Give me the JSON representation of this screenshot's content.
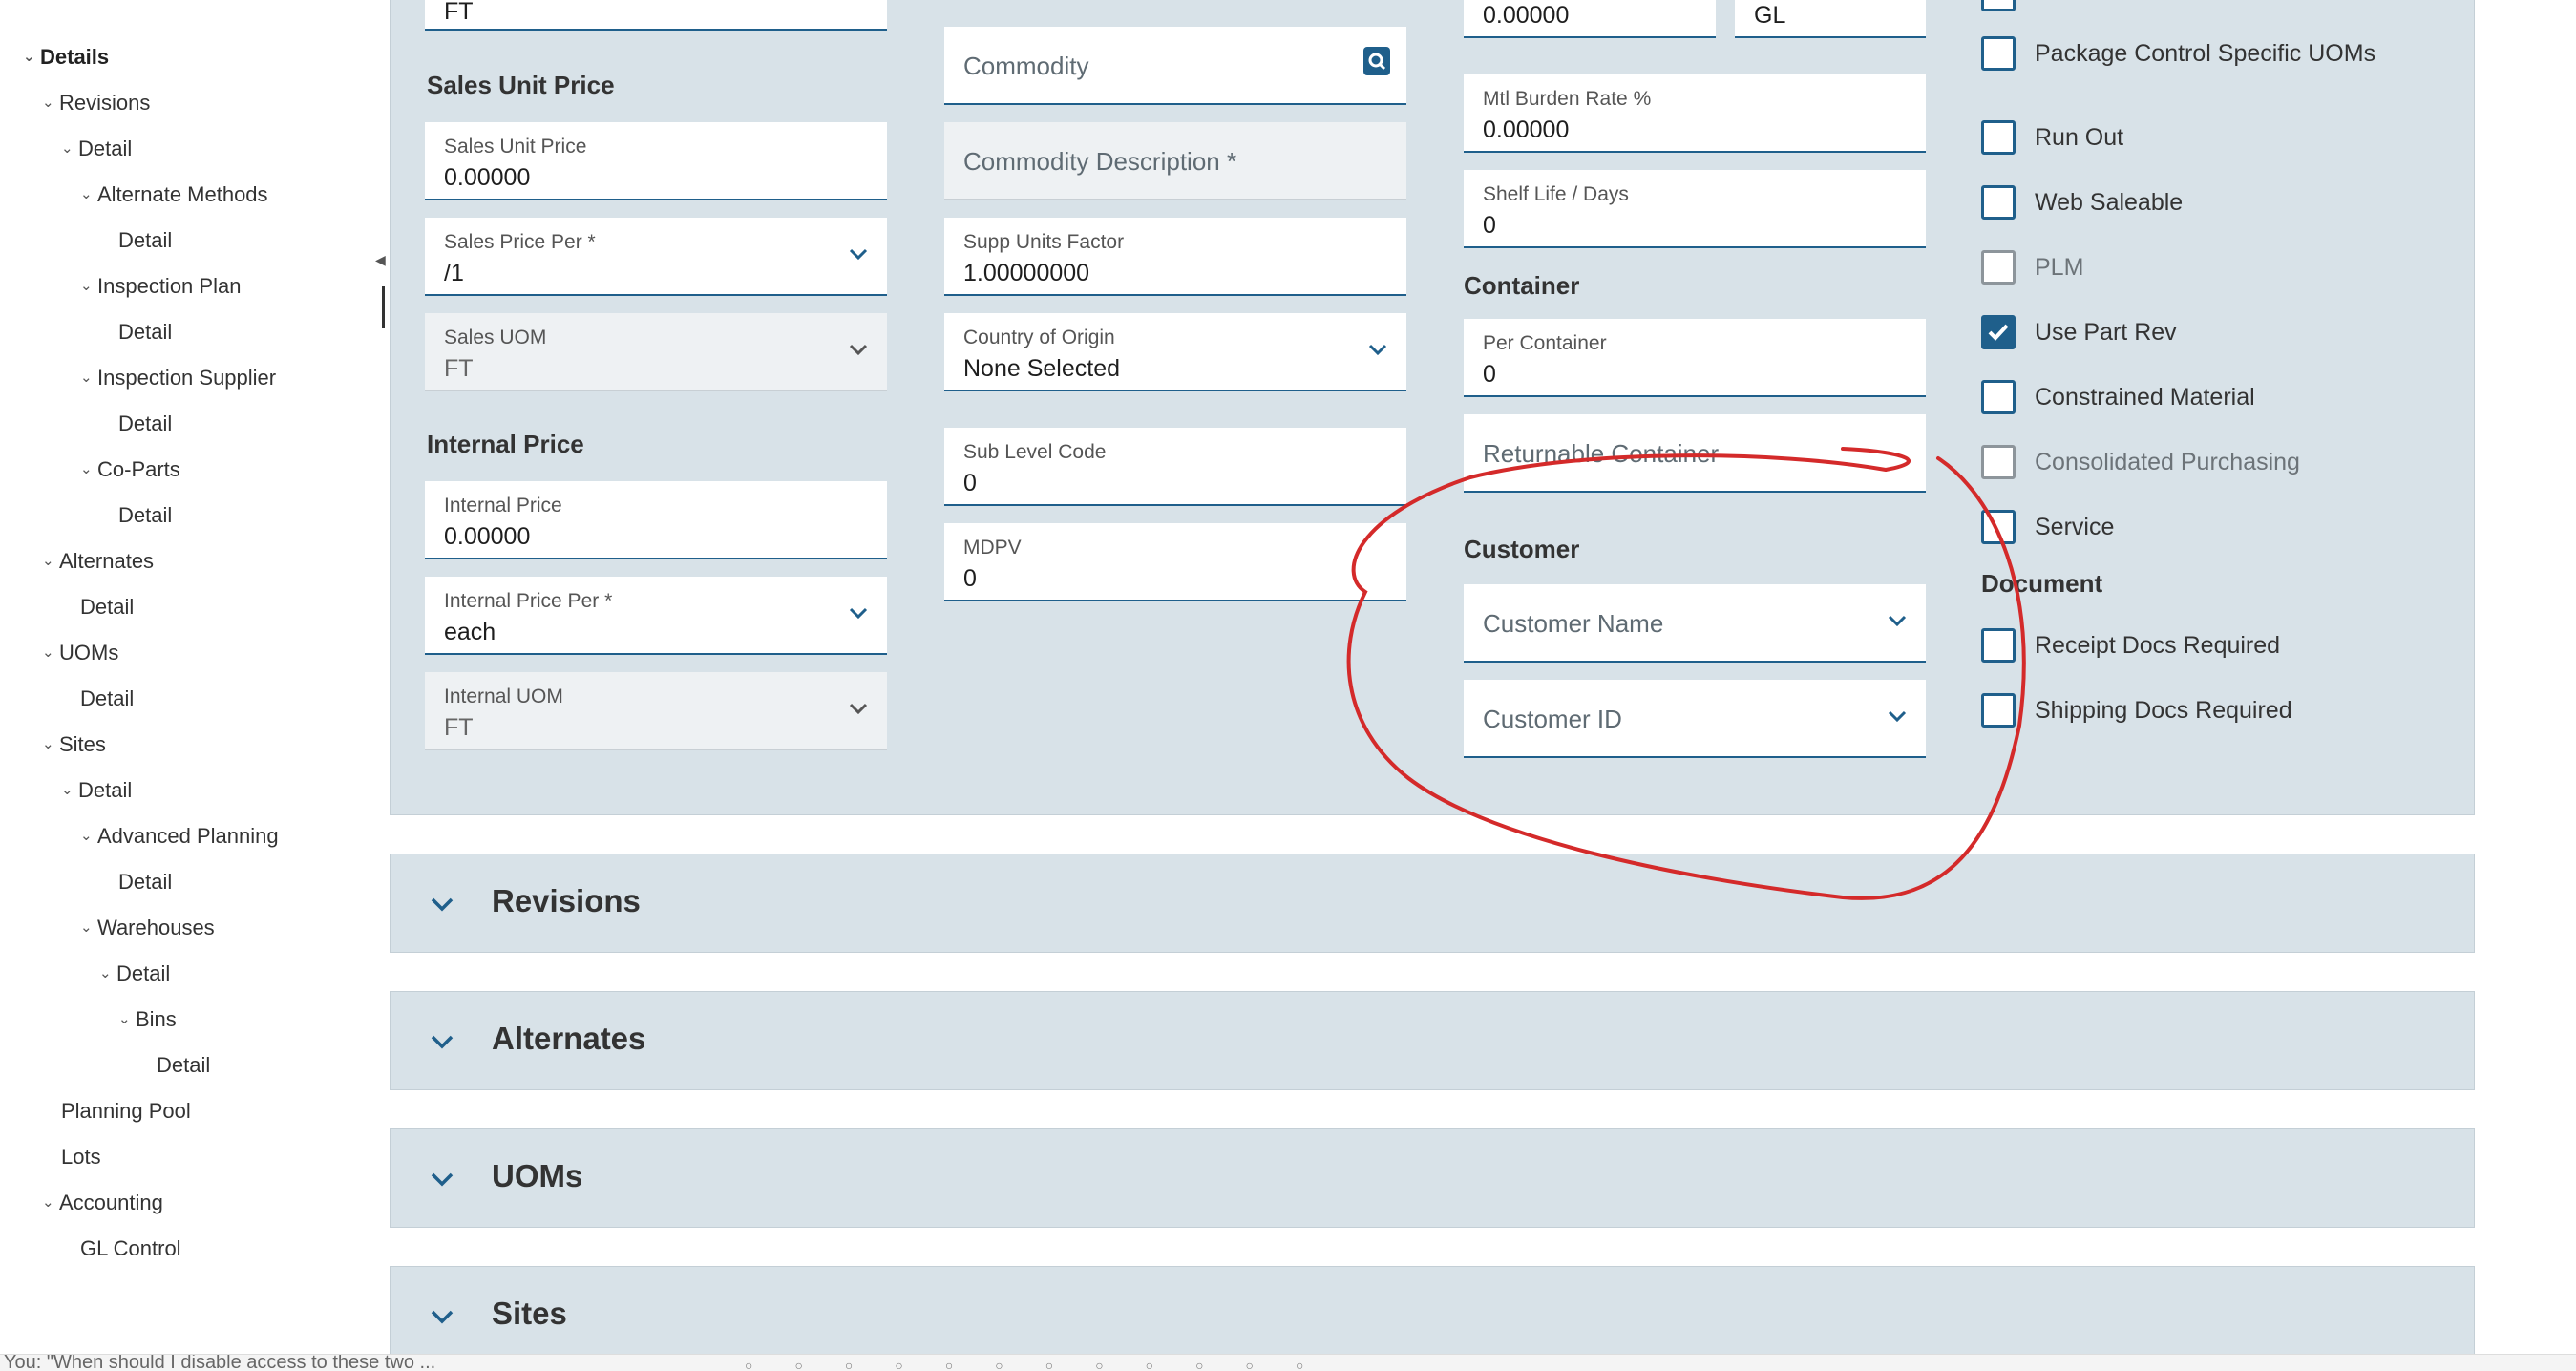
{
  "tree": {
    "items": [
      {
        "label": "Details",
        "chevron": true,
        "bold": true
      },
      {
        "label": "Revisions",
        "chevron": true
      },
      {
        "label": "Detail",
        "chevron": true
      },
      {
        "label": "Alternate Methods",
        "chevron": true
      },
      {
        "label": "Detail",
        "chevron": false
      },
      {
        "label": "Inspection Plan",
        "chevron": true
      },
      {
        "label": "Detail",
        "chevron": false
      },
      {
        "label": "Inspection Supplier",
        "chevron": true
      },
      {
        "label": "Detail",
        "chevron": false
      },
      {
        "label": "Co-Parts",
        "chevron": true
      },
      {
        "label": "Detail",
        "chevron": false
      },
      {
        "label": "Alternates",
        "chevron": true
      },
      {
        "label": "Detail",
        "chevron": false
      },
      {
        "label": "UOMs",
        "chevron": true
      },
      {
        "label": "Detail",
        "chevron": false
      },
      {
        "label": "Sites",
        "chevron": true
      },
      {
        "label": "Detail",
        "chevron": true
      },
      {
        "label": "Advanced Planning",
        "chevron": true
      },
      {
        "label": "Detail",
        "chevron": false
      },
      {
        "label": "Warehouses",
        "chevron": true
      },
      {
        "label": "Detail",
        "chevron": true
      },
      {
        "label": "Bins",
        "chevron": true
      },
      {
        "label": "Detail",
        "chevron": false
      },
      {
        "label": "Planning Pool",
        "chevron": false
      },
      {
        "label": "Lots",
        "chevron": false
      },
      {
        "label": "Accounting",
        "chevron": true
      },
      {
        "label": "GL Control",
        "chevron": false
      }
    ]
  },
  "col1": {
    "top_value": "FT",
    "sales_section": "Sales Unit Price",
    "sales_unit_price": {
      "label": "Sales Unit Price",
      "value": "0.00000"
    },
    "sales_price_per": {
      "label": "Sales Price Per *",
      "value": "/1"
    },
    "sales_uom": {
      "label": "Sales UOM",
      "value": "FT"
    },
    "internal_section": "Internal Price",
    "internal_price": {
      "label": "Internal Price",
      "value": "0.00000"
    },
    "internal_price_per": {
      "label": "Internal Price Per *",
      "value": "each"
    },
    "internal_uom": {
      "label": "Internal UOM",
      "value": "FT"
    }
  },
  "col2": {
    "commodity": {
      "placeholder": "Commodity"
    },
    "commodity_desc": {
      "placeholder": "Commodity Description *"
    },
    "supp_units": {
      "label": "Supp Units Factor",
      "value": "1.00000000"
    },
    "country": {
      "label": "Country of Origin",
      "value": "None Selected"
    },
    "sub_level": {
      "label": "Sub Level Code",
      "value": "0"
    },
    "mdpv": {
      "label": "MDPV",
      "value": "0"
    }
  },
  "col3": {
    "top_value": "0.00000",
    "top_select": "GL",
    "mtl_burden": {
      "label": "Mtl Burden Rate %",
      "value": "0.00000"
    },
    "shelf_life": {
      "label": "Shelf Life / Days",
      "value": "0"
    },
    "container_section": "Container",
    "per_container": {
      "label": "Per Container",
      "value": "0"
    },
    "returnable": {
      "placeholder": "Returnable Container"
    },
    "customer_section": "Customer",
    "customer_name": {
      "placeholder": "Customer Name"
    },
    "customer_id": {
      "placeholder": "Customer ID"
    }
  },
  "col4": {
    "checkboxes": [
      {
        "label": "Package Control Specific UOMs",
        "checked": false,
        "disabled": false
      },
      {
        "label": "Run Out",
        "checked": false,
        "disabled": false
      },
      {
        "label": "Web Saleable",
        "checked": false,
        "disabled": false
      },
      {
        "label": "PLM",
        "checked": false,
        "disabled": true
      },
      {
        "label": "Use Part Rev",
        "checked": true,
        "disabled": false
      },
      {
        "label": "Constrained Material",
        "checked": false,
        "disabled": false
      },
      {
        "label": "Consolidated Purchasing",
        "checked": false,
        "disabled": true
      },
      {
        "label": "Service",
        "checked": false,
        "disabled": false
      }
    ],
    "document_section": "Document",
    "doc_checkboxes": [
      {
        "label": "Receipt Docs Required",
        "checked": false,
        "disabled": false
      },
      {
        "label": "Shipping Docs Required",
        "checked": false,
        "disabled": false
      }
    ]
  },
  "accordions": [
    {
      "title": "Revisions"
    },
    {
      "title": "Alternates"
    },
    {
      "title": "UOMs"
    },
    {
      "title": "Sites"
    }
  ],
  "statusbar": {
    "text": "You: \"When should I disable access to these two ..."
  },
  "colors": {
    "accent": "#1f5f8b",
    "panel": "#d8e2e8",
    "annotation": "#d42a2a"
  }
}
